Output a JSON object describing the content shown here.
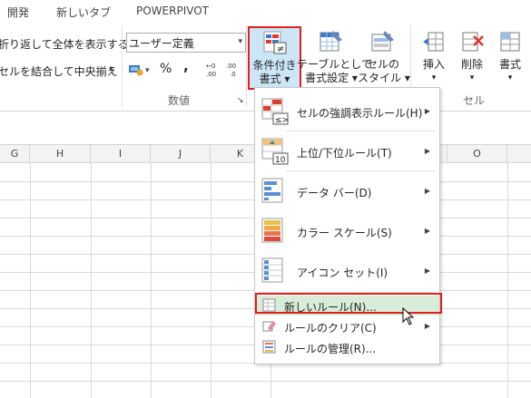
{
  "tabs": [
    "開発",
    "新しいタブ",
    "POWERPIVOT"
  ],
  "ribbon": {
    "wrap_text": "折り返して全体を表示する",
    "merge_center": "セルを結合して中央揃え",
    "number_format": "ユーザー定義",
    "percent": "%",
    "comma": ",",
    "number_group": "数値",
    "cells_group": "セル",
    "cond_format": [
      "条件付き",
      "書式 ▾"
    ],
    "format_table": [
      "テーブルとして",
      "書式設定 ▾"
    ],
    "cell_style": [
      "セルの",
      "スタイル ▾"
    ],
    "insert": [
      "挿入",
      "▾"
    ],
    "delete": [
      "削除",
      "▾"
    ],
    "format": [
      "書式",
      "▾"
    ],
    "inc_decimal": ".00",
    "dec_decimal": ".0",
    "colors": {
      "accent_red": "#e0201f",
      "highlight_green": "#d7ecd9",
      "pressed_bg": "#cde6f7"
    }
  },
  "columns": [
    "G",
    "H",
    "I",
    "J",
    "K",
    "O"
  ],
  "menu": {
    "items": [
      {
        "label": "セルの強調表示ルール(H)",
        "icon": "highlight-rules-icon"
      },
      {
        "label": "上位/下位ルール(T)",
        "icon": "top-bottom-icon",
        "icon_text": "10"
      },
      {
        "label": "データ バー(D)",
        "icon": "data-bars-icon"
      },
      {
        "label": "カラー スケール(S)",
        "icon": "color-scales-icon"
      },
      {
        "label": "アイコン セット(I)",
        "icon": "icon-sets-icon"
      }
    ],
    "sub_items": [
      {
        "label": "新しいルール(N)...",
        "icon": "new-rule-icon"
      },
      {
        "label": "ルールのクリア(C)",
        "icon": "clear-rules-icon"
      },
      {
        "label": "ルールの管理(R)...",
        "icon": "manage-rules-icon"
      }
    ]
  }
}
